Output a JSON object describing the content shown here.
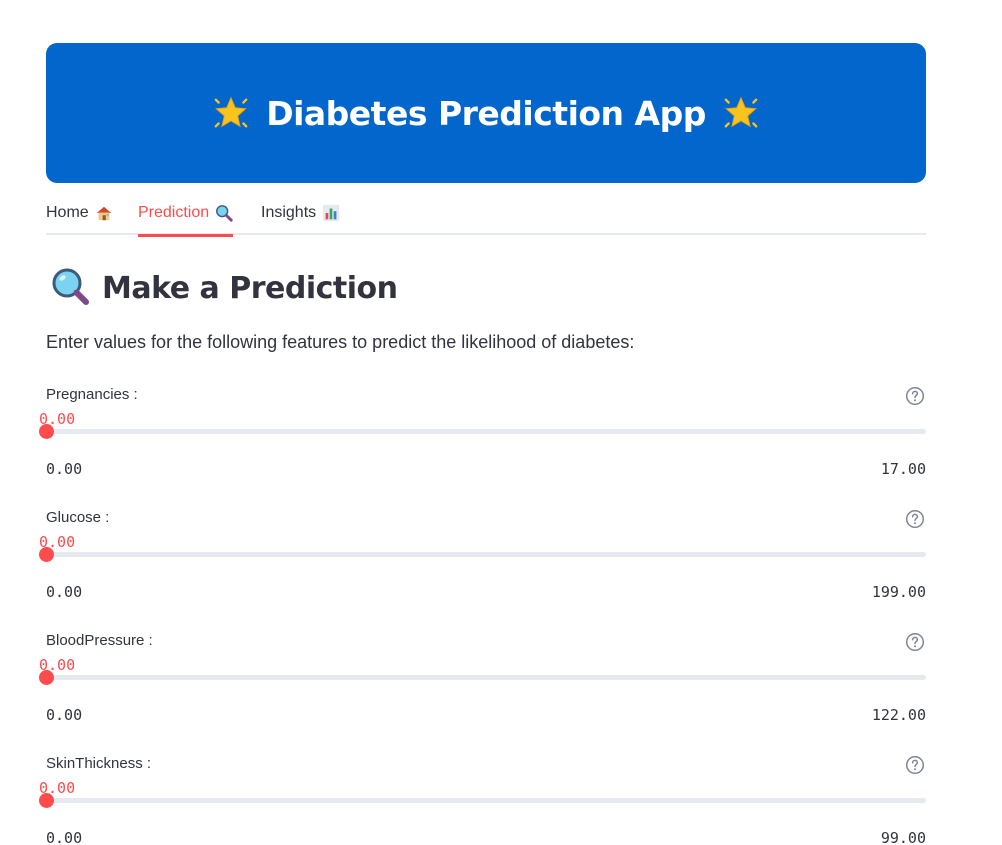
{
  "banner": {
    "title": "Diabetes Prediction App",
    "left_icon": "glowing-star-icon",
    "right_icon": "glowing-star-icon",
    "background": "#0366cc"
  },
  "tabs": [
    {
      "label": "Home",
      "icon": "house-icon",
      "active": false
    },
    {
      "label": "Prediction",
      "icon": "magnifier-icon",
      "active": true
    },
    {
      "label": "Insights",
      "icon": "bar-chart-icon",
      "active": false
    }
  ],
  "prediction": {
    "heading": "Make a Prediction",
    "heading_icon": "magnifier-icon",
    "intro": "Enter values for the following features to predict the likelihood of diabetes:",
    "accent": "#ff4b4b",
    "sliders": [
      {
        "label": "Pregnancies :",
        "value": "0.00",
        "min": "0.00",
        "max": "17.00",
        "fraction": 0
      },
      {
        "label": "Glucose :",
        "value": "0.00",
        "min": "0.00",
        "max": "199.00",
        "fraction": 0
      },
      {
        "label": "BloodPressure :",
        "value": "0.00",
        "min": "0.00",
        "max": "122.00",
        "fraction": 0
      },
      {
        "label": "SkinThickness :",
        "value": "0.00",
        "min": "0.00",
        "max": "99.00",
        "fraction": 0
      }
    ]
  }
}
